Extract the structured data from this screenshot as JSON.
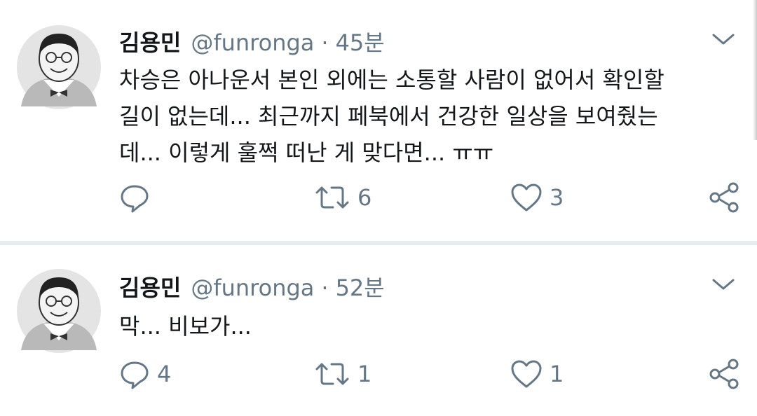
{
  "tweets": [
    {
      "display_name": "김용민",
      "handle": "@funronga",
      "separator": "·",
      "time": "45분",
      "text_lines": [
        "차승은 아나운서 본인 외에는 소통할 사람이 없어서 확인할",
        "길이 없는데... 최근까지 페북에서 건강한 일상을 보여줬는",
        "데... 이렇게 훌쩍 떠난 게 맞다면... ㅠㅠ"
      ],
      "reply_count": "",
      "retweet_count": "6",
      "like_count": "3"
    },
    {
      "display_name": "김용민",
      "handle": "@funronga",
      "separator": "·",
      "time": "52분",
      "text_lines": [
        "막... 비보가..."
      ],
      "reply_count": "4",
      "retweet_count": "1",
      "like_count": "1"
    }
  ],
  "icons": {
    "reply": "reply-icon",
    "retweet": "retweet-icon",
    "like": "heart-icon",
    "share": "share-icon",
    "menu": "chevron-down-icon"
  },
  "colors": {
    "text": "#14171a",
    "muted": "#657786",
    "divider": "#e6ecf0"
  }
}
